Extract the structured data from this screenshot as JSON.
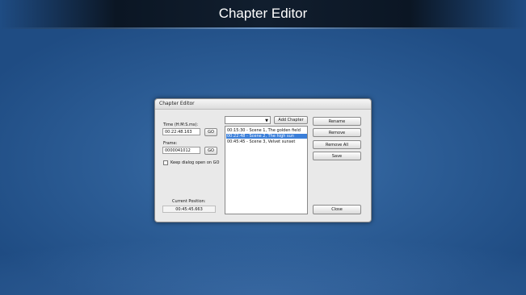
{
  "banner": {
    "title": "Chapter Editor"
  },
  "dialog": {
    "title": "Chapter Editor",
    "time_label": "Time (H:M:S.ms):",
    "time_value": "00:22:48.163",
    "go_label": "GO",
    "frame_label": "Frame:",
    "frame_value": "0000041012",
    "keep_open_label": "Keep dialog open on GO",
    "keep_open_checked": false,
    "current_position_label": "Current Position:",
    "current_position_value": "00:45:45.663",
    "combo_value": "",
    "add_chapter_label": "Add Chapter",
    "chapters": [
      {
        "text": "00:15:30 - Scene 1, The golden field",
        "selected": false
      },
      {
        "text": "00:22:48 - Scene 2, The high sun",
        "selected": true
      },
      {
        "text": "00:45:45 - Scene 3, Velvet sunset",
        "selected": false
      }
    ],
    "buttons": {
      "rename": "Rename",
      "remove": "Remove",
      "remove_all": "Remove All",
      "save": "Save",
      "close": "Close"
    }
  }
}
